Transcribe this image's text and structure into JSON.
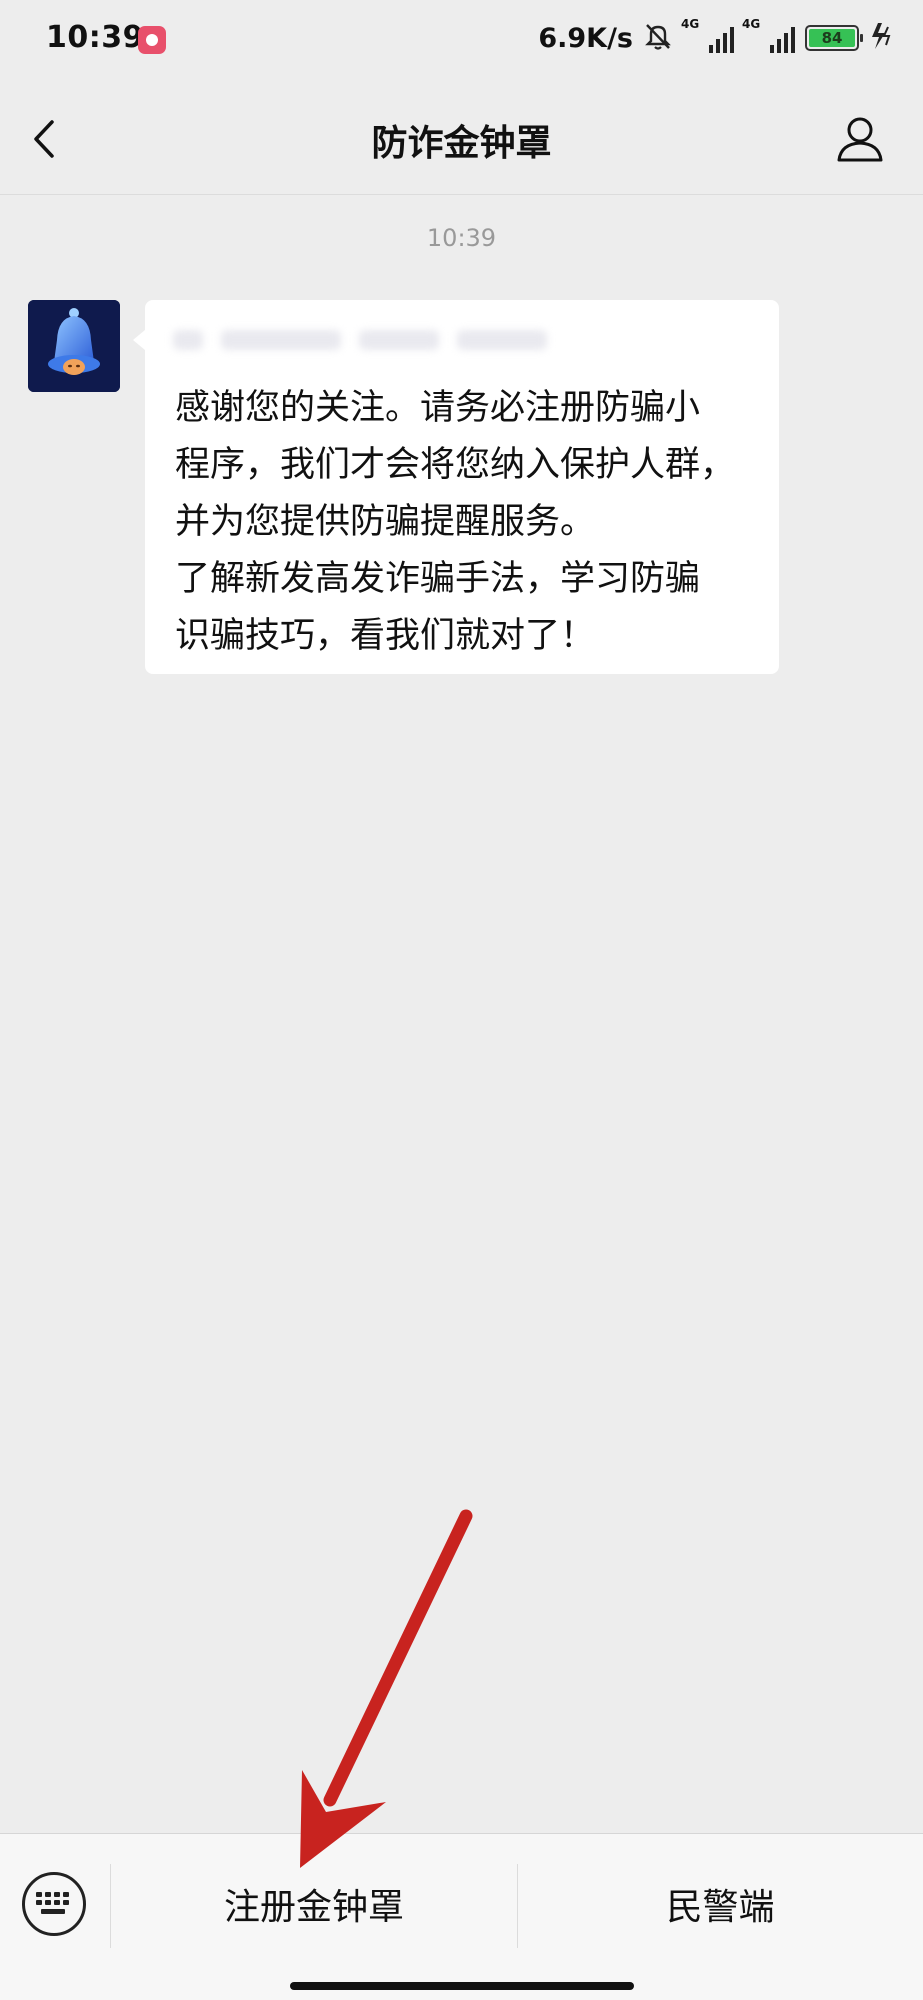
{
  "status_bar": {
    "time": "10:39",
    "network_speed": "6.9K/s",
    "signal1_label": "4G",
    "signal2_label": "4G",
    "battery": "84",
    "icons": [
      "record-icon",
      "mute-icon",
      "signal-icon",
      "battery-icon",
      "charging-icon"
    ]
  },
  "header": {
    "title": "防诈金钟罩",
    "back_icon": "back-chevron-icon",
    "profile_icon": "user-profile-icon"
  },
  "chat": {
    "timestamp": "10:39",
    "message": {
      "lines": [
        "感谢您的关注。请务必注册防骗小",
        "程序，我们才会将您纳入保护人群，",
        "并为您提供防骗提醒服务。",
        "了解新发高发诈骗手法，学习防骗",
        "识骗技巧，看我们就对了！"
      ]
    }
  },
  "bottom_menu": {
    "keyboard_icon": "keyboard-icon",
    "items": [
      {
        "label": "注册金钟罩"
      },
      {
        "label": "民警端"
      }
    ]
  },
  "colors": {
    "background": "#ededed",
    "bubble": "#ffffff",
    "annotation_arrow": "#c8231f",
    "battery_fill": "#36c155"
  }
}
